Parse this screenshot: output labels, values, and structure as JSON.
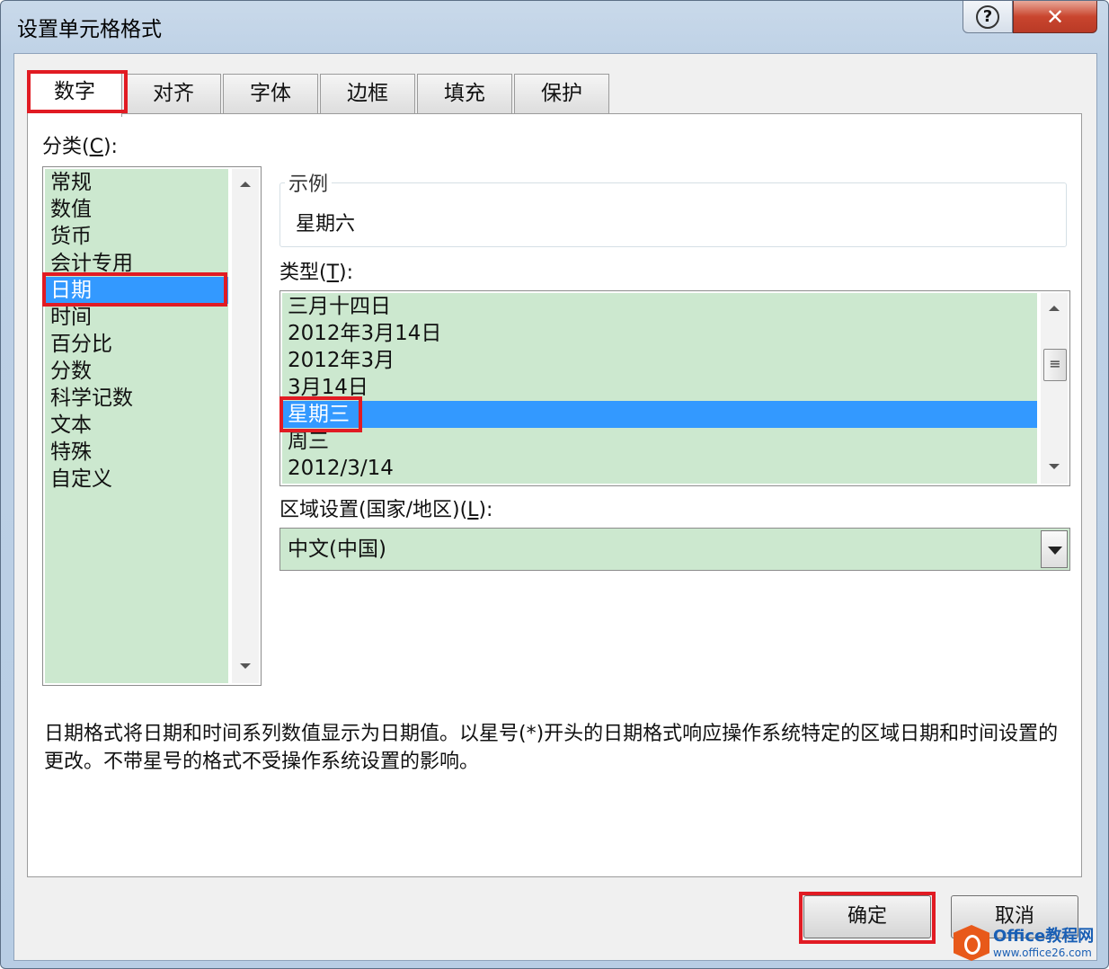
{
  "window": {
    "title": "设置单元格格式"
  },
  "caption": {
    "help_icon": "question-mark-icon",
    "help_glyph": "?",
    "close_icon": "close-x-icon",
    "close_glyph": "✕"
  },
  "tabs": [
    {
      "label": "数字",
      "active": true
    },
    {
      "label": "对齐"
    },
    {
      "label": "字体"
    },
    {
      "label": "边框"
    },
    {
      "label": "填充"
    },
    {
      "label": "保护"
    }
  ],
  "category": {
    "label_prefix": "分类(",
    "label_key": "C",
    "label_suffix": "):",
    "items": [
      "常规",
      "数值",
      "货币",
      "会计专用",
      "日期",
      "时间",
      "百分比",
      "分数",
      "科学记数",
      "文本",
      "特殊",
      "自定义"
    ],
    "selected": "日期"
  },
  "sample": {
    "legend": "示例",
    "value": "星期六"
  },
  "type": {
    "label_prefix": "类型(",
    "label_key": "T",
    "label_suffix": "):",
    "items": [
      "三月十四日",
      "2012年3月14日",
      "2012年3月",
      "3月14日",
      "星期三",
      "周三",
      "2012/3/14"
    ],
    "selected": "星期三",
    "thumb_glyph": "≡"
  },
  "locale": {
    "label_prefix": "区域设置(国家/地区)(",
    "label_key": "L",
    "label_suffix": "):",
    "value": "中文(中国)"
  },
  "description": "日期格式将日期和时间系列数值显示为日期值。以星号(*)开头的日期格式响应操作系统特定的区域日期和时间设置的更改。不带星号的格式不受操作系统设置的影响。",
  "buttons": {
    "ok": "确定",
    "cancel": "取消"
  },
  "watermark": {
    "line1": "Office教程网",
    "line2": "www.office26.com"
  },
  "colors": {
    "highlight": "#3399ff",
    "list_bg": "#cce8cf",
    "annotation_red": "#e11b23"
  }
}
